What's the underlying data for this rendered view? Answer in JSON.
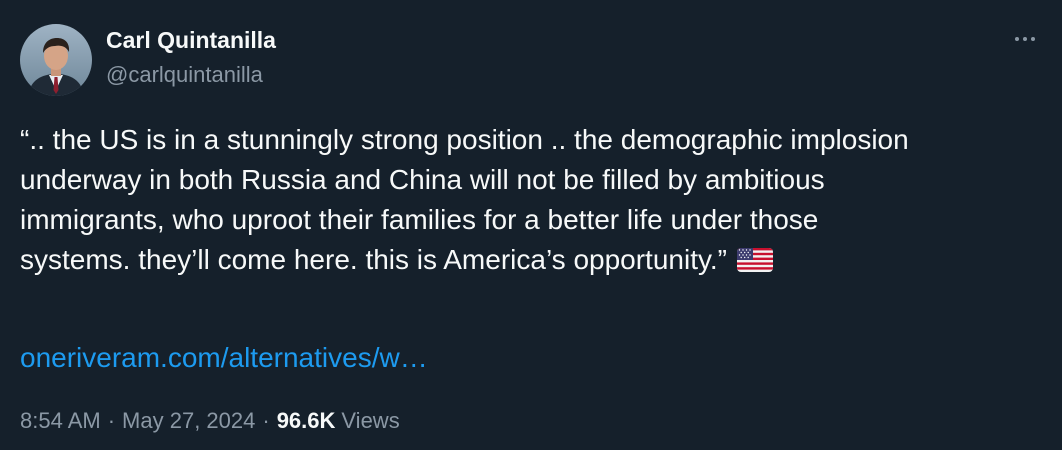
{
  "author": {
    "display_name": "Carl Quintanilla",
    "handle": "@carlquintanilla"
  },
  "tweet": {
    "lines": [
      "“.. the US is in a stunningly strong position .. the demographic implosion",
      "underway in both Russia and China will not be filled by ambitious",
      "immigrants, who uproot their families for a better life under those",
      "systems. they’ll come here. this is America’s opportunity.”"
    ],
    "emoji": "us-flag-icon",
    "link_text": "oneriveram.com/alternatives/w…"
  },
  "meta": {
    "time": "8:54 AM",
    "separator": "·",
    "date": "May 27, 2024",
    "views_count": "96.6K",
    "views_label": "Views"
  },
  "colors": {
    "background": "#15202b",
    "text_primary": "#f7f9f9",
    "text_secondary": "#8b98a5",
    "link": "#1d9bf0"
  }
}
